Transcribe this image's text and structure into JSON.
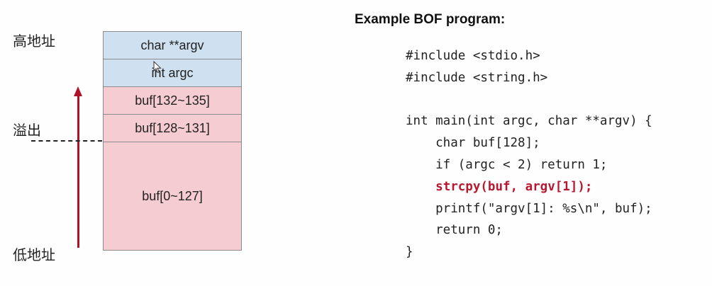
{
  "labels": {
    "high_address": "高地址",
    "overflow": "溢出",
    "low_address": "低地址"
  },
  "stack_cells": [
    {
      "text": "char **argv",
      "color": "#cfe0f1"
    },
    {
      "text": "int argc",
      "color": "#cfe0f1"
    },
    {
      "text": "buf[132~135]",
      "color": "#f4ccd1"
    },
    {
      "text": "buf[128~131]",
      "color": "#f4ccd1"
    },
    {
      "text": "buf[0~127]",
      "color": "#f4ccd1"
    }
  ],
  "arrow_color": "#b0122a",
  "code_title": "Example BOF program:",
  "code_lines": {
    "l1": "#include <stdio.h>",
    "l2": "#include <string.h>",
    "l3": "int main(int argc, char **argv) {",
    "l4": "    char buf[128];",
    "l5": "    if (argc < 2) return 1;",
    "l6_indent": "    ",
    "l6": "strcpy(buf, argv[1]);",
    "l7": "    printf(\"argv[1]: %s\\n\", buf);",
    "l8": "    return 0;",
    "l9": "}"
  },
  "highlight_color": "#b8172f"
}
